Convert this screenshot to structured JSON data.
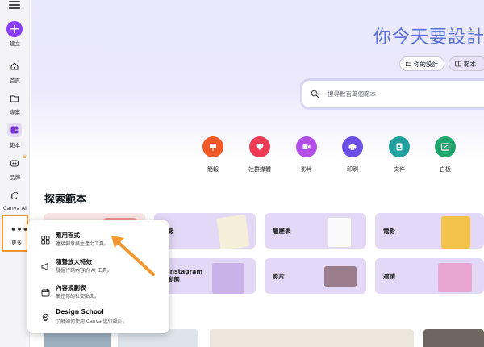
{
  "sidebar": {
    "create_label": "建立",
    "items": [
      {
        "label": "首頁",
        "icon": "home-icon"
      },
      {
        "label": "專案",
        "icon": "folder-icon"
      },
      {
        "label": "範本",
        "icon": "templates-icon"
      },
      {
        "label": "品牌",
        "icon": "brand-icon"
      },
      {
        "label": "Canva AI",
        "icon": "canva-ai-icon"
      },
      {
        "label": "更多",
        "icon": "more-icon"
      }
    ]
  },
  "hero": {
    "title": "你今天要設計些",
    "tab_designs": "你的設計",
    "tab_templates": "範本",
    "search_placeholder": "搜尋數百萬個範本"
  },
  "categories": [
    {
      "label": "簡報",
      "color": "#f05a28"
    },
    {
      "label": "社群媒體",
      "color": "#ee3b55"
    },
    {
      "label": "影片",
      "color": "#b14ee6"
    },
    {
      "label": "印刷",
      "color": "#6a4ee6"
    },
    {
      "label": "文件",
      "color": "#21a0a0"
    },
    {
      "label": "白板",
      "color": "#1fa46b"
    }
  ],
  "section_title": "探索範本",
  "template_cards": [
    {
      "label": "報"
    },
    {
      "label": "履歷表"
    },
    {
      "label": "電影"
    },
    {
      "label": "Instagram 動態"
    },
    {
      "label": "影片"
    },
    {
      "label": "邀請"
    }
  ],
  "popup_menu": [
    {
      "title": "應用程式",
      "desc": "連接創意與生產力工具。",
      "icon": "apps-icon"
    },
    {
      "title": "隨聲放大特效",
      "desc": "發掘行銷內容的 AI 工具。",
      "icon": "megaphone-icon"
    },
    {
      "title": "內容規劃表",
      "desc": "掌控你的社交貼文。",
      "icon": "calendar-icon"
    },
    {
      "title": "Design School",
      "desc": "了解如何使用 Canva 進行設計。",
      "icon": "lightbulb-icon"
    }
  ],
  "colors": {
    "accent": "#8b3dff",
    "highlight_box": "#f5972f",
    "hero_text": "#5a6fd8"
  }
}
